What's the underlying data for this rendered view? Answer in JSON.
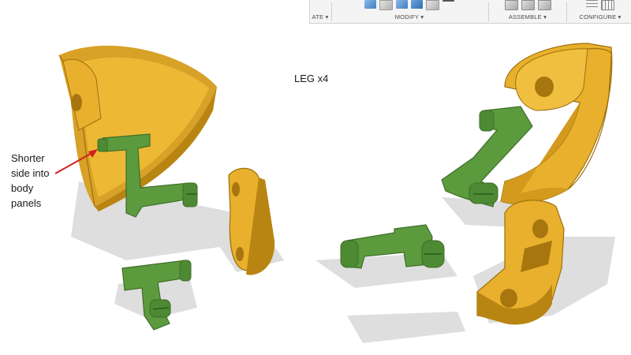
{
  "toolbar": {
    "create_label": "ATE ▾",
    "modify_label": "MODIFY ▾",
    "assemble_label": "ASSEMBLE ▾",
    "configure_label": "CONFIGURE ▾"
  },
  "annotations": {
    "title": "LEG x4",
    "callout_line1": "Shorter",
    "callout_line2": "side into",
    "callout_line3": "body",
    "callout_line4": "panels"
  },
  "colors": {
    "part_yellow": "#e8b02c",
    "part_yellow_dark": "#b98512",
    "part_green": "#5c9a3e",
    "part_green_dark": "#3e6e28",
    "arrow_red": "#d42020",
    "shadow": "#dedede"
  }
}
